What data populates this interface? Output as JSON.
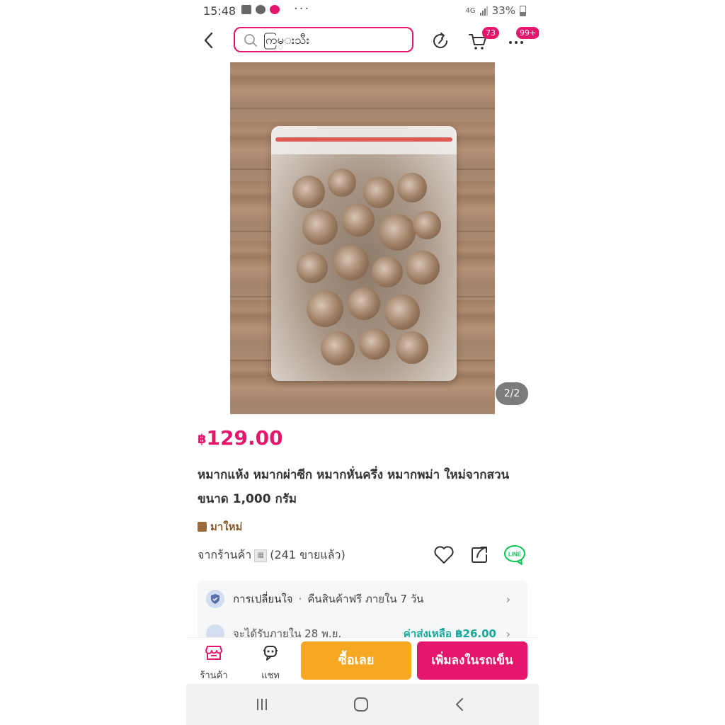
{
  "status_bar": {
    "time": "15:48",
    "network": "4G",
    "battery": "33%",
    "overflow": "···"
  },
  "header": {
    "search_value": "ကြမ္းသီး",
    "cart_count": "73",
    "more_count": "99+"
  },
  "product": {
    "image_counter": "2/2",
    "currency": "฿",
    "price": "129.00",
    "title": "หมากแห้ง หมากผ่าซีก หมากหั่นครึ่ง หมากพม่า ใหม่จากสวน ขนาด 1,000 กรัม",
    "new_label": "มาใหม่",
    "shop_prefix": "จากร้านค้า",
    "sold_text": "(241 ขายแล้ว)",
    "line_label": "LINE"
  },
  "info_card": {
    "return_title": "การเปลี่ยนใจ",
    "return_separator": "·",
    "return_detail": "คืนสินค้าฟรี ภายใน 7 วัน",
    "delivery_text": "จะได้รับภายใน 28 พ.ย.",
    "shipping_text": "ค่าส่งเหลือ ฿26.00"
  },
  "bottom_bar": {
    "shop_label": "ร้านค้า",
    "chat_label": "แชท",
    "buy_now": "ซื้อเลย",
    "add_to_cart": "เพิ่มลงในรถเข็น"
  },
  "colors": {
    "accent": "#e5176d",
    "buy_button": "#f7a823",
    "line_green": "#06c755",
    "shipping_teal": "#15a89a"
  }
}
